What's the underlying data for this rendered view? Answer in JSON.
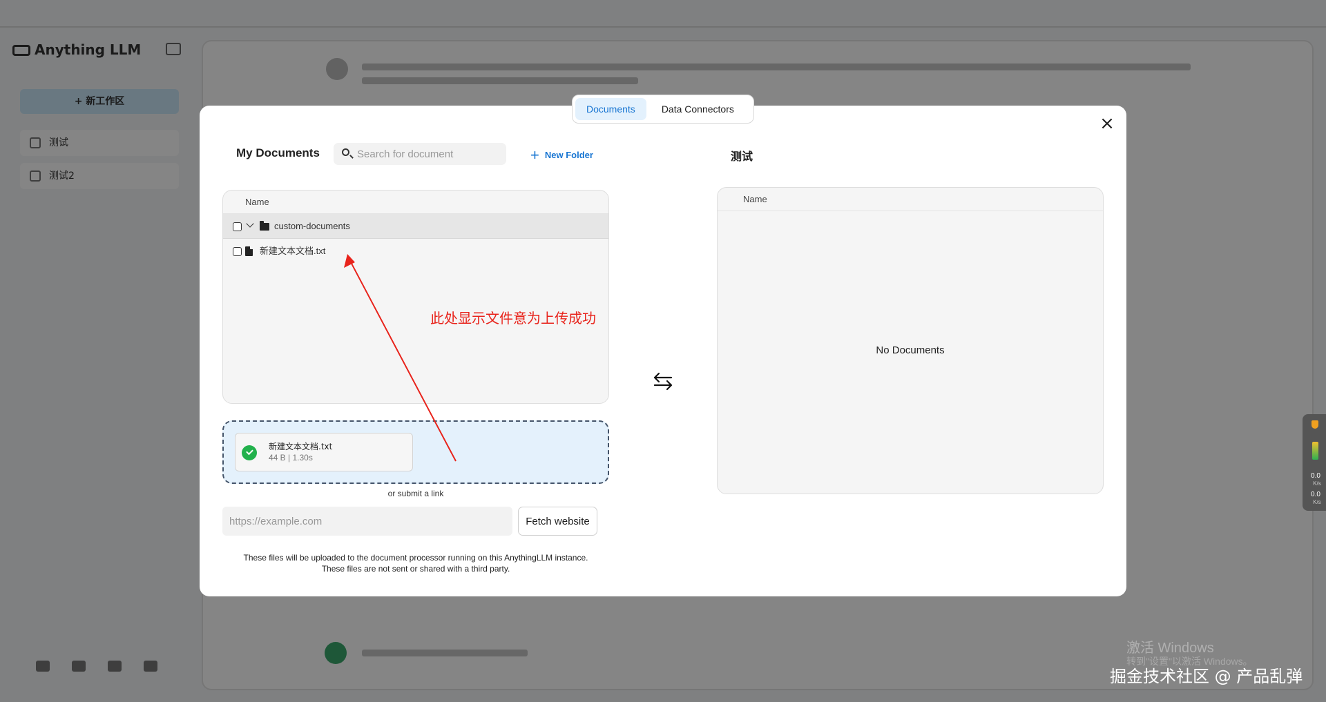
{
  "background_app": {
    "brand": "Anything LLM",
    "new_workspace_label": "+ 新工作区",
    "workspaces": [
      "测试",
      "测试2"
    ]
  },
  "modal": {
    "tabs": [
      {
        "label": "Documents",
        "active": true
      },
      {
        "label": "Data Connectors",
        "active": false
      }
    ],
    "my_documents": {
      "title": "My Documents",
      "search_placeholder": "Search for document",
      "new_folder_label": "New Folder",
      "column_name": "Name",
      "rows": [
        {
          "type": "folder",
          "label": "custom-documents"
        },
        {
          "type": "file",
          "label": "新建文本文档.txt"
        }
      ]
    },
    "upload": {
      "file_name": "新建文本文档.txt",
      "file_meta": "44 B | 1.30s",
      "status": "success",
      "submit_link_text": "or submit a link",
      "url_placeholder": "https://example.com",
      "fetch_button": "Fetch website",
      "disclaimer_line1": "These files will be uploaded to the document processor running on this AnythingLLM instance.",
      "disclaimer_line2": "These files are not sent or shared with a third party."
    },
    "workspace_panel": {
      "title": "测试",
      "column_name": "Name",
      "empty_text": "No Documents"
    }
  },
  "annotation": {
    "text": "此处显示文件意为上传成功",
    "color": "#e8231b"
  },
  "overlay": {
    "windows_watermark_line1": "激活 Windows",
    "windows_watermark_line2": "转到\"设置\"以激活 Windows。",
    "credit": "掘金技术社区 @ 产品乱弹",
    "net_up": "0.0",
    "net_up_unit": "K/s",
    "net_down": "0.0",
    "net_down_unit": "K/s"
  },
  "colors": {
    "accent": "#1976d2",
    "success": "#22b14c",
    "dropzone_bg": "#e4f1fc"
  }
}
